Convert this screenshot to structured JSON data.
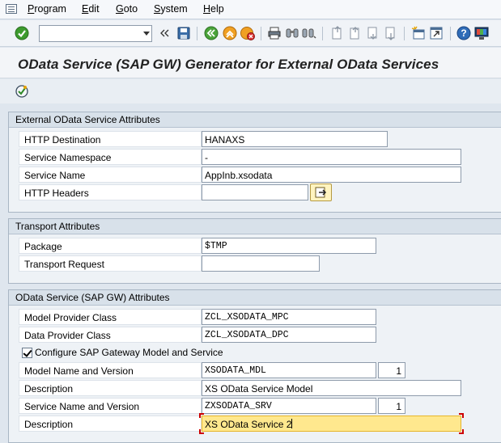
{
  "menu": {
    "items": [
      {
        "label": "Program",
        "key": "P",
        "rest": "rogram"
      },
      {
        "label": "Edit",
        "key": "E",
        "rest": "dit"
      },
      {
        "label": "Goto",
        "key": "G",
        "rest": "oto"
      },
      {
        "label": "System",
        "key": "S",
        "rest": "ystem"
      },
      {
        "label": "Help",
        "key": "H",
        "rest": "elp"
      }
    ]
  },
  "toolbar": {
    "command_field_value": "",
    "icons": [
      "enter-check-icon",
      "save-icon",
      "back-icon",
      "exit-icon",
      "cancel-icon",
      "print-icon",
      "find-icon",
      "find-next-icon",
      "first-page-icon",
      "previous-page-icon",
      "next-page-icon",
      "last-page-icon",
      "create-session-icon",
      "shortcut-icon",
      "help-icon",
      "customize-layout-icon"
    ]
  },
  "page": {
    "title": "OData Service (SAP GW) Generator for External OData Services"
  },
  "groups": {
    "external": {
      "title": "External OData Service Attributes",
      "http_destination_label": "HTTP Destination",
      "http_destination_value": "HANAXS",
      "service_namespace_label": "Service Namespace",
      "service_namespace_value": "-",
      "service_name_label": "Service Name",
      "service_name_value": "AppInb.xsodata",
      "http_headers_label": "HTTP Headers",
      "http_headers_value": ""
    },
    "transport": {
      "title": "Transport Attributes",
      "package_label": "Package",
      "package_value": "$TMP",
      "transport_request_label": "Transport Request",
      "transport_request_value": ""
    },
    "odata": {
      "title": "OData Service (SAP GW) Attributes",
      "mpc_label": "Model Provider Class",
      "mpc_value": "ZCL_XSODATA_MPC",
      "dpc_label": "Data Provider Class",
      "dpc_value": "ZCL_XSODATA_DPC",
      "configure_label": "Configure SAP Gateway Model and Service",
      "configure_checked": true,
      "model_name_label": "Model Name and Version",
      "model_name_value": "XSODATA_MDL",
      "model_version_value": "1",
      "model_desc_label": "Description",
      "model_desc_value": "XS OData Service Model",
      "service_name_label": "Service Name and Version",
      "service_name_value": "ZXSODATA_SRV",
      "service_version_value": "1",
      "service_desc_label": "Description",
      "service_desc_value": "XS OData Service 2"
    }
  },
  "colors": {
    "background": "#dfe6ee",
    "group_header": "#d8e1ea",
    "active_field": "#ffe88e",
    "required_marker": "#cc0000"
  }
}
